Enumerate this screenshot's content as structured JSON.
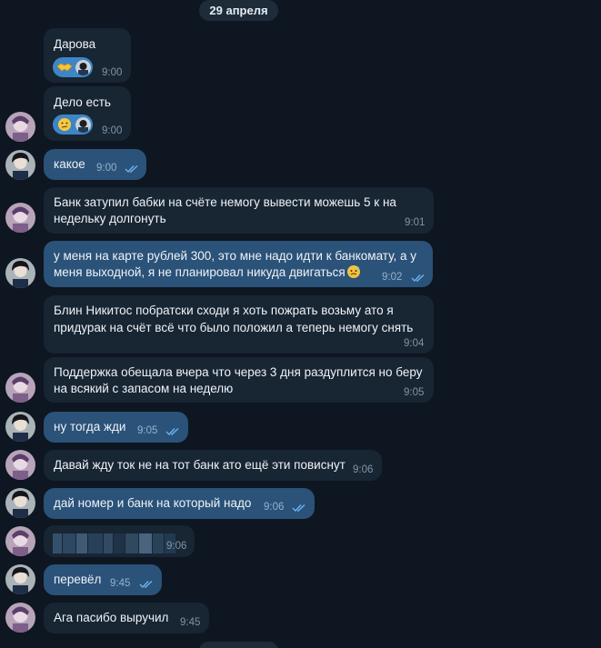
{
  "date_header": "29 апреля",
  "messages": [
    {
      "text": "Дарова",
      "time": "9:00",
      "reaction_emoji": "handshake-icon"
    },
    {
      "text": "Дело есть",
      "time": "9:00",
      "reaction_emoji": "thinking-face-icon"
    },
    {
      "text": "какое",
      "time": "9:00"
    },
    {
      "line1": "Банк затупил бабки на счёте немогу вывести можешь 5 к на",
      "line2": "недельку долгонуть",
      "time": "9:01"
    },
    {
      "line1": "у меня на карте рублей 300, это мне надо идти к банкомату, а у",
      "line2": "меня выходной, я не планировал никуда двигаться",
      "time": "9:02"
    },
    {
      "line1": "Блин Никитос побратски сходи я хоть пожрать возьму ато я",
      "line2": "придурак на счёт всё что было положил а теперь немогу снять",
      "time": "9:04"
    },
    {
      "line1": "Поддержка обещала вчера что через 3 дня раздуплится но беру",
      "line2": "на всякий с запасом на неделю",
      "time": "9:05"
    },
    {
      "text": "ну тогда жди",
      "time": "9:05"
    },
    {
      "text": "Давай жду ток не на тот банк ато ещё эти повиснут",
      "time": "9:06"
    },
    {
      "text": "дай номер и банк на который надо",
      "time": "9:06"
    },
    {
      "time": "9:06"
    },
    {
      "text": "перевёл",
      "time": "9:45"
    },
    {
      "text": "Ага пасибо выручил",
      "time": "9:45"
    }
  ],
  "colors": {
    "background": "#0e1621",
    "incoming_bubble": "#182533",
    "outgoing_bubble": "#2b5278",
    "reaction_chip": "#3d86c6",
    "read_checks": "#6ab3f3"
  }
}
